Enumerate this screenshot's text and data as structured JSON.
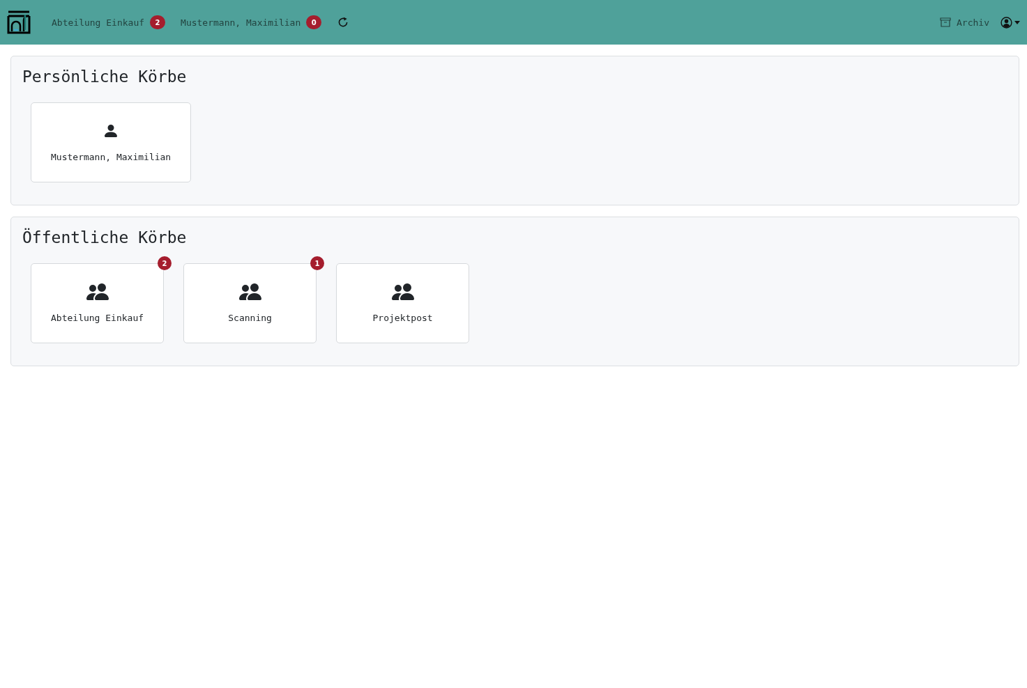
{
  "navbar": {
    "links": [
      {
        "label": "Abteilung Einkauf",
        "badge": "2"
      },
      {
        "label": "Mustermann, Maximilian",
        "badge": "0"
      }
    ],
    "archive": {
      "label": "Archiv"
    }
  },
  "sections": [
    {
      "title": "Persönliche Körbe",
      "kind": "personal",
      "baskets": [
        {
          "name": "Mustermann, Maximilian"
        }
      ]
    },
    {
      "title": "Öffentliche Körbe",
      "kind": "group",
      "baskets": [
        {
          "name": "Abteilung Einkauf",
          "badge": "2"
        },
        {
          "name": "Scanning",
          "badge": "1"
        },
        {
          "name": "Projektpost"
        }
      ]
    }
  ]
}
